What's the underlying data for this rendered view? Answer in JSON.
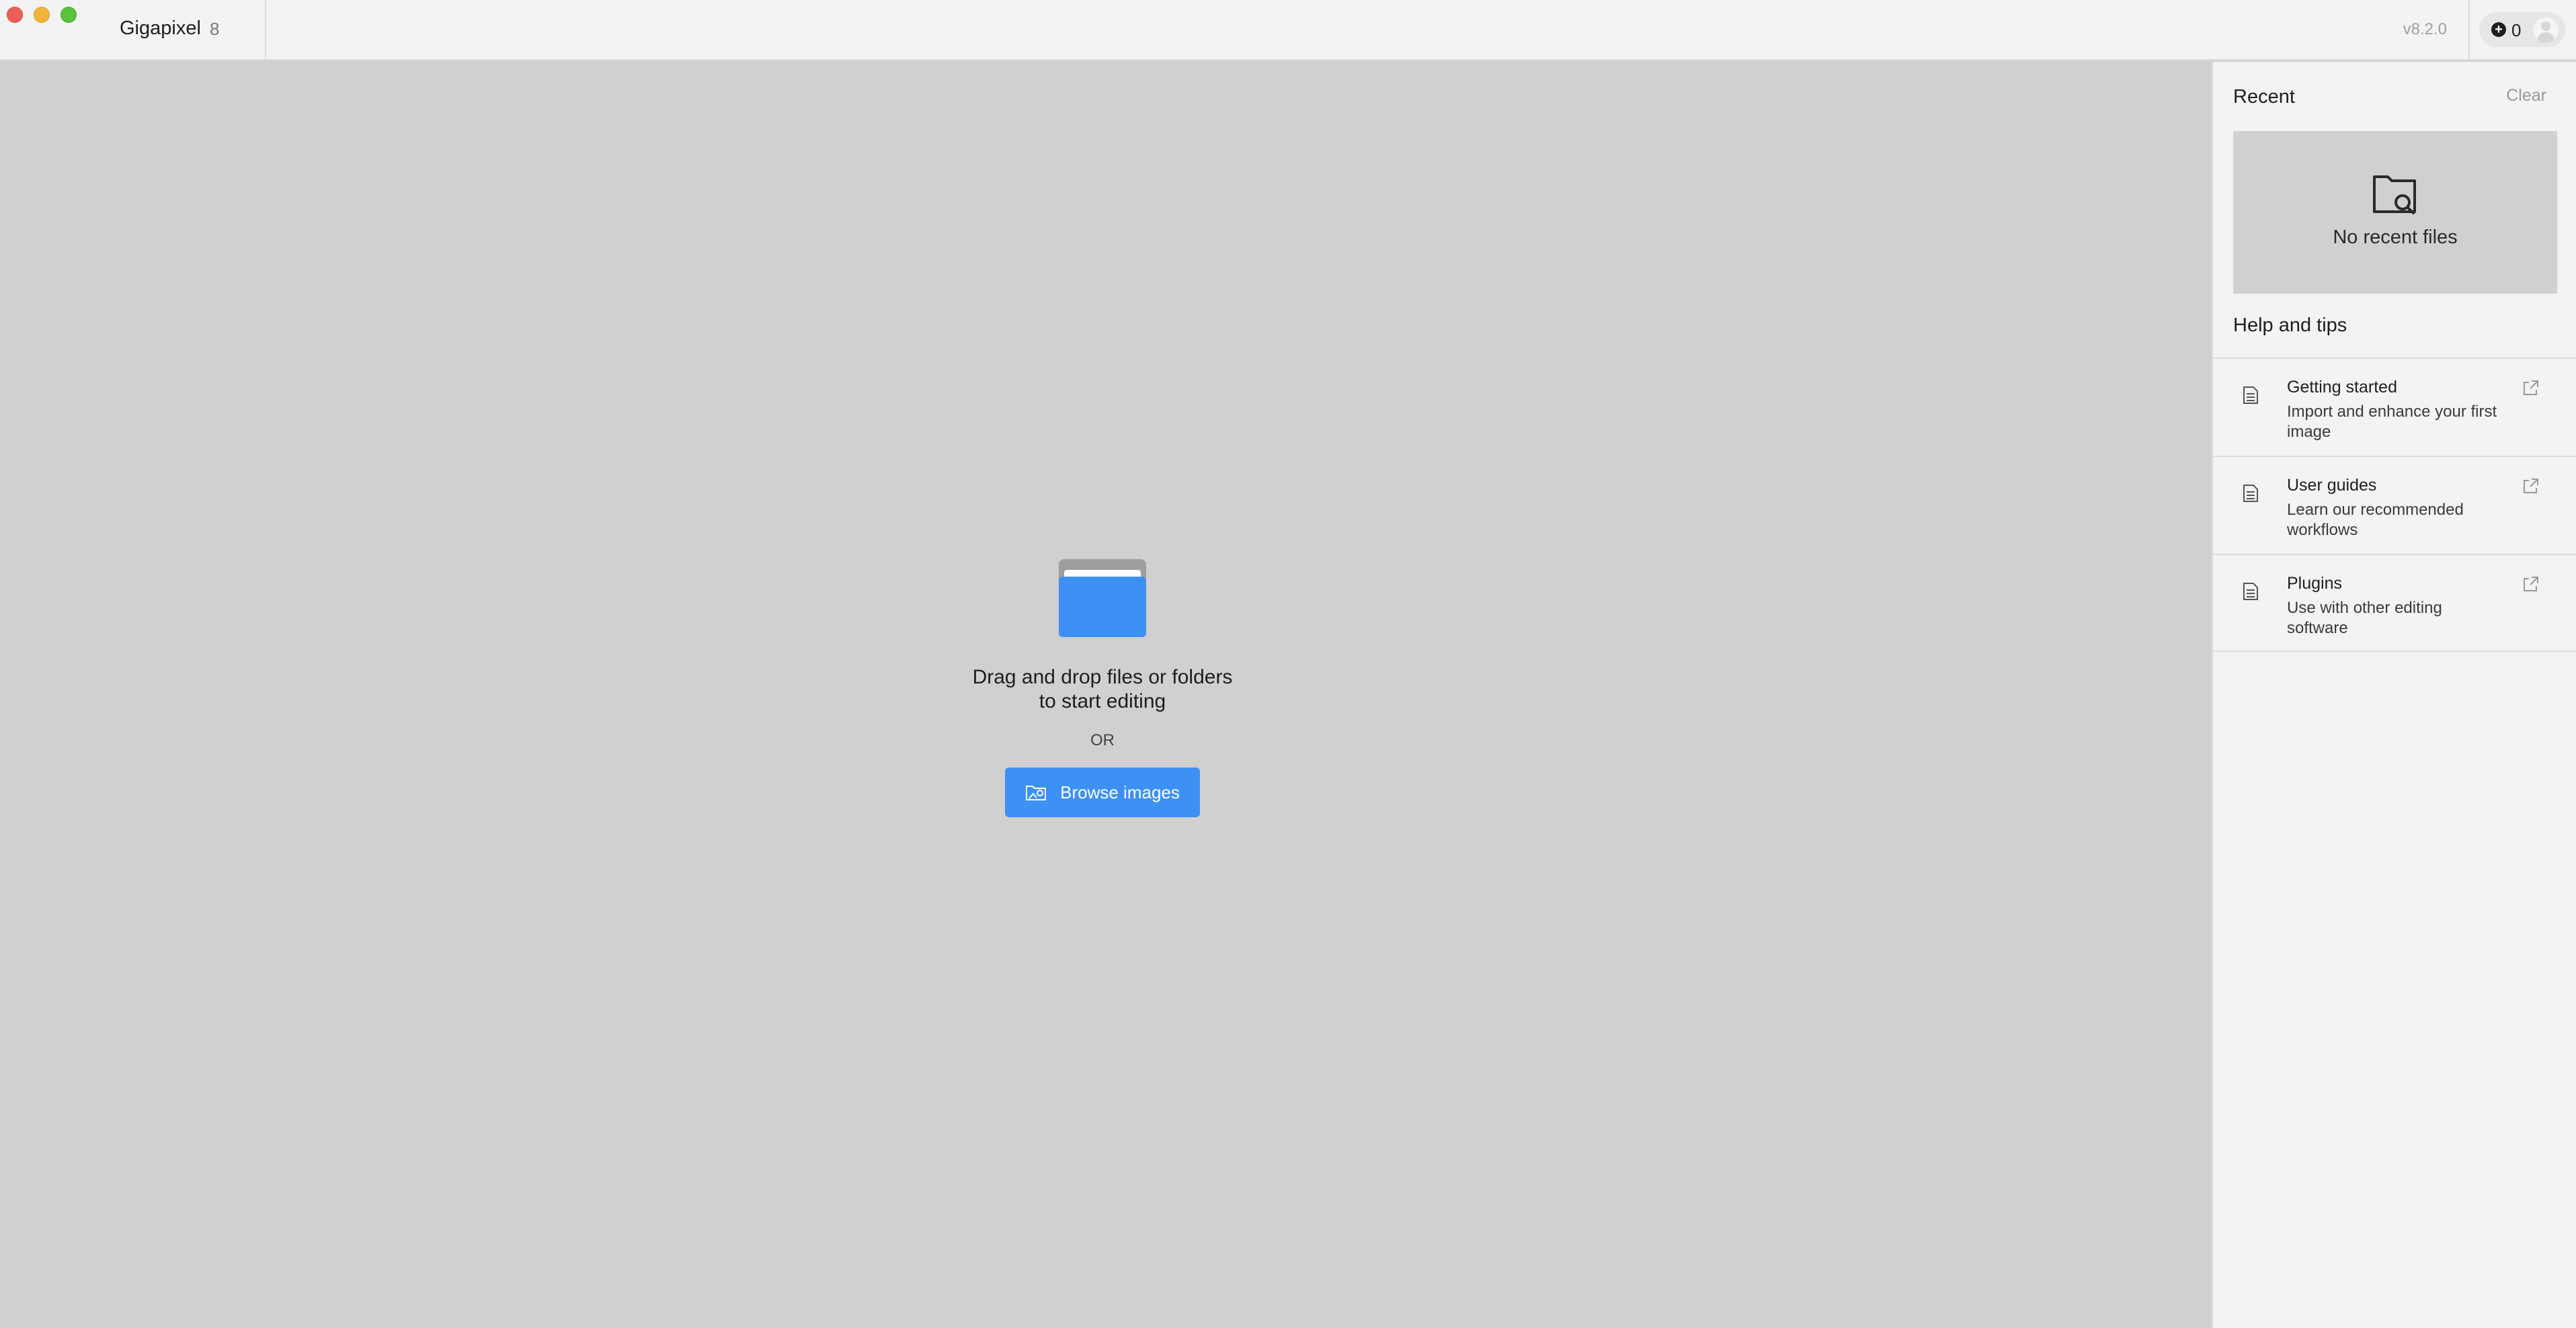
{
  "titlebar": {
    "app_name": "Gigapixel",
    "app_major": "8",
    "version": "v8.2.0",
    "credits": "0"
  },
  "main": {
    "drop_line1": "Drag and drop files or folders",
    "drop_line2": "to start editing",
    "or": "OR",
    "browse_label": "Browse images"
  },
  "sidebar": {
    "recent_title": "Recent",
    "clear_label": "Clear",
    "no_recent": "No recent files",
    "help_title": "Help and tips",
    "help_items": [
      {
        "title": "Getting started",
        "desc": "Import and enhance your first image"
      },
      {
        "title": "User guides",
        "desc": "Learn our recommended workflows"
      },
      {
        "title": "Plugins",
        "desc": "Use with other editing software"
      }
    ]
  },
  "colors": {
    "accent": "#3d91f4",
    "canvas_bg": "#d0d0d0",
    "panel_bg": "#f3f3f3"
  },
  "icons": [
    "folder-icon",
    "image-folder-icon",
    "folder-search-icon",
    "document-icon",
    "external-link-icon",
    "plus-icon",
    "avatar-icon"
  ]
}
